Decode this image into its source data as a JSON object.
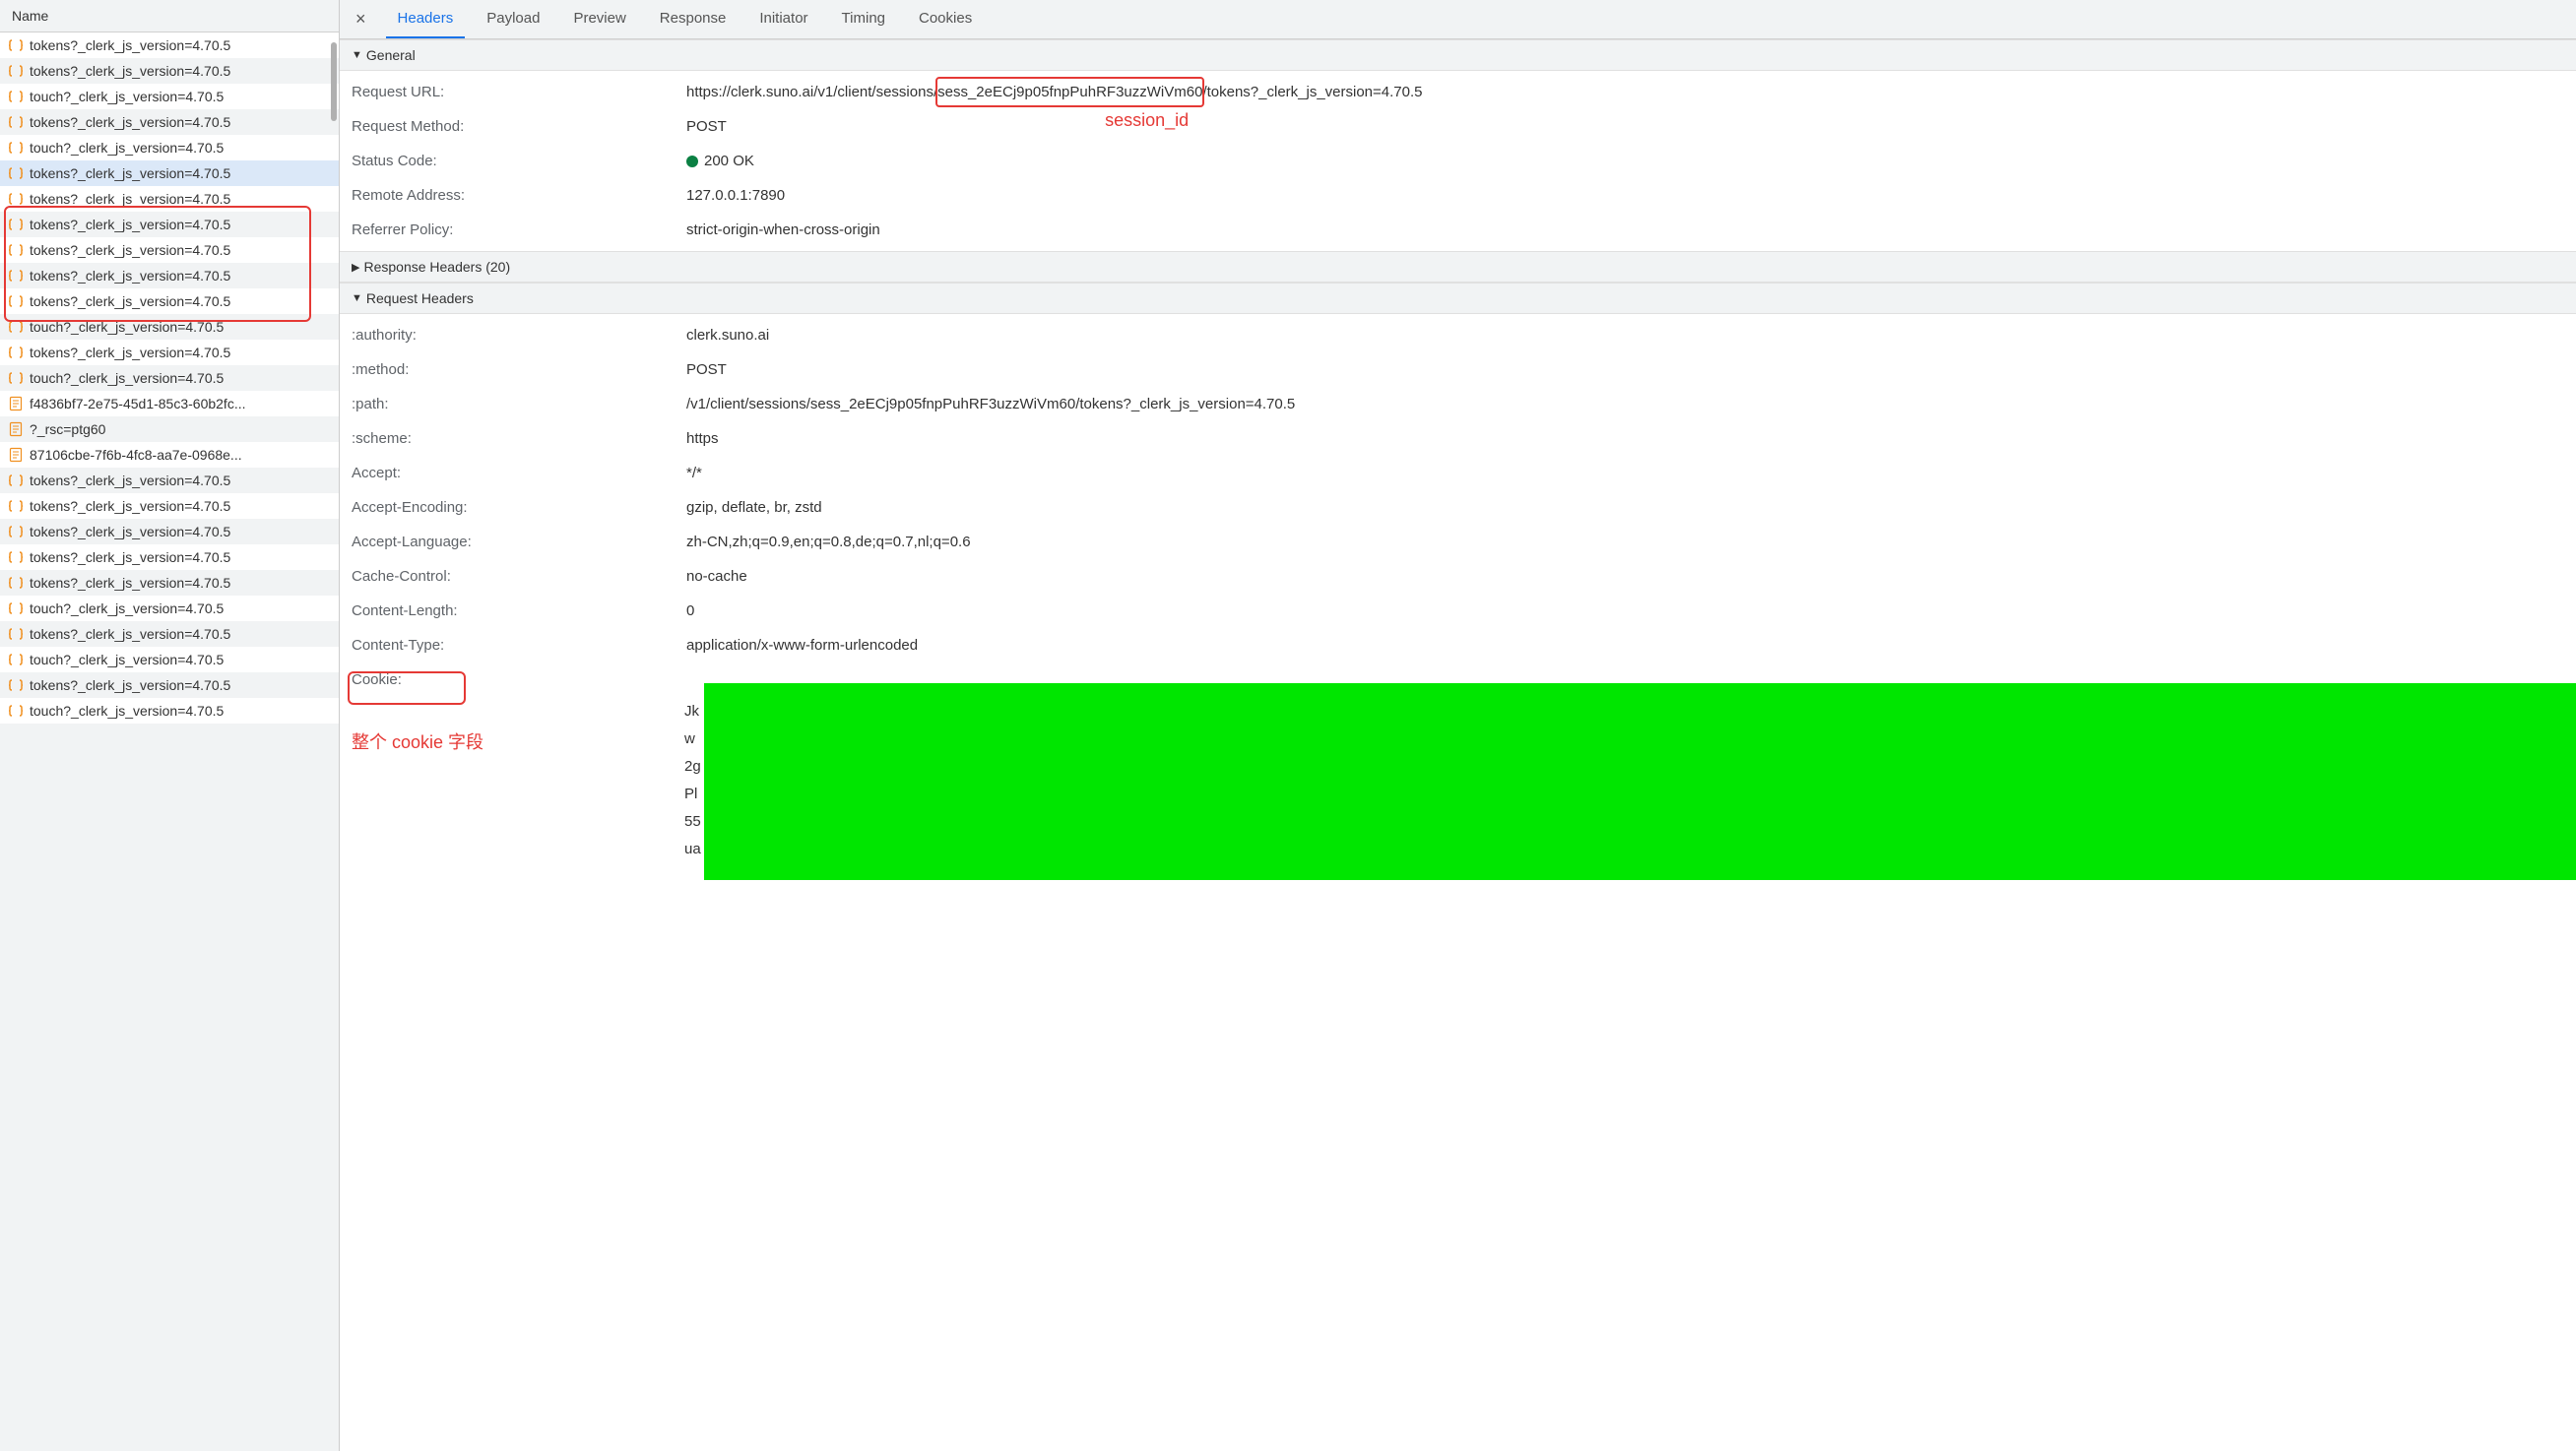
{
  "left": {
    "header": "Name",
    "items": [
      {
        "type": "json",
        "name": "tokens?_clerk_js_version=4.70.5"
      },
      {
        "type": "json",
        "name": "tokens?_clerk_js_version=4.70.5"
      },
      {
        "type": "json",
        "name": "touch?_clerk_js_version=4.70.5"
      },
      {
        "type": "json",
        "name": "tokens?_clerk_js_version=4.70.5"
      },
      {
        "type": "json",
        "name": "touch?_clerk_js_version=4.70.5"
      },
      {
        "type": "json",
        "name": "tokens?_clerk_js_version=4.70.5",
        "selected": true
      },
      {
        "type": "json",
        "name": "tokens?_clerk_js_version=4.70.5"
      },
      {
        "type": "json",
        "name": "tokens?_clerk_js_version=4.70.5"
      },
      {
        "type": "json",
        "name": "tokens?_clerk_js_version=4.70.5"
      },
      {
        "type": "json",
        "name": "tokens?_clerk_js_version=4.70.5"
      },
      {
        "type": "json",
        "name": "tokens?_clerk_js_version=4.70.5"
      },
      {
        "type": "json",
        "name": "touch?_clerk_js_version=4.70.5"
      },
      {
        "type": "json",
        "name": "tokens?_clerk_js_version=4.70.5"
      },
      {
        "type": "json",
        "name": "touch?_clerk_js_version=4.70.5"
      },
      {
        "type": "doc",
        "name": "f4836bf7-2e75-45d1-85c3-60b2fc..."
      },
      {
        "type": "doc",
        "name": "?_rsc=ptg60"
      },
      {
        "type": "doc",
        "name": "87106cbe-7f6b-4fc8-aa7e-0968e..."
      },
      {
        "type": "json",
        "name": "tokens?_clerk_js_version=4.70.5"
      },
      {
        "type": "json",
        "name": "tokens?_clerk_js_version=4.70.5"
      },
      {
        "type": "json",
        "name": "tokens?_clerk_js_version=4.70.5"
      },
      {
        "type": "json",
        "name": "tokens?_clerk_js_version=4.70.5"
      },
      {
        "type": "json",
        "name": "tokens?_clerk_js_version=4.70.5"
      },
      {
        "type": "json",
        "name": "touch?_clerk_js_version=4.70.5"
      },
      {
        "type": "json",
        "name": "tokens?_clerk_js_version=4.70.5"
      },
      {
        "type": "json",
        "name": "touch?_clerk_js_version=4.70.5"
      },
      {
        "type": "json",
        "name": "tokens?_clerk_js_version=4.70.5"
      },
      {
        "type": "json",
        "name": "touch?_clerk_js_version=4.70.5"
      }
    ]
  },
  "tabs": {
    "list": [
      "Headers",
      "Payload",
      "Preview",
      "Response",
      "Initiator",
      "Timing",
      "Cookies"
    ],
    "active": 0
  },
  "sections": {
    "general": {
      "title": "General",
      "items": [
        {
          "k": "Request URL:",
          "v": "https://clerk.suno.ai/v1/client/sessions/sess_2eECj9p05fnpPuhRF3uzzWiVm60/tokens?_clerk_js_version=4.70.5",
          "wrap": true,
          "sessHighlight": "sess_2eECj9p05fnpPuhRF3uzzWiVm60"
        },
        {
          "k": "Request Method:",
          "v": "POST"
        },
        {
          "k": "Status Code:",
          "v": "200 OK",
          "dot": true
        },
        {
          "k": "Remote Address:",
          "v": "127.0.0.1:7890"
        },
        {
          "k": "Referrer Policy:",
          "v": "strict-origin-when-cross-origin"
        }
      ]
    },
    "response_headers": {
      "title": "Response Headers (20)",
      "collapsed": true
    },
    "request_headers": {
      "title": "Request Headers",
      "items": [
        {
          "k": ":authority:",
          "v": "clerk.suno.ai"
        },
        {
          "k": ":method:",
          "v": "POST"
        },
        {
          "k": ":path:",
          "v": "/v1/client/sessions/sess_2eECj9p05fnpPuhRF3uzzWiVm60/tokens?_clerk_js_version=4.70.5"
        },
        {
          "k": ":scheme:",
          "v": "https"
        },
        {
          "k": "Accept:",
          "v": "*/*"
        },
        {
          "k": "Accept-Encoding:",
          "v": "gzip, deflate, br, zstd"
        },
        {
          "k": "Accept-Language:",
          "v": "zh-CN,zh;q=0.9,en;q=0.8,de;q=0.7,nl;q=0.6"
        },
        {
          "k": "Cache-Control:",
          "v": "no-cache"
        },
        {
          "k": "Content-Length:",
          "v": "0"
        },
        {
          "k": "Content-Type:",
          "v": "application/x-www-form-urlencoded"
        },
        {
          "k": "Cookie:",
          "v": "",
          "redacted": true
        }
      ]
    }
  },
  "annotations": {
    "session_label": "session_id",
    "cookie_label": "整个 cookie 字段"
  }
}
